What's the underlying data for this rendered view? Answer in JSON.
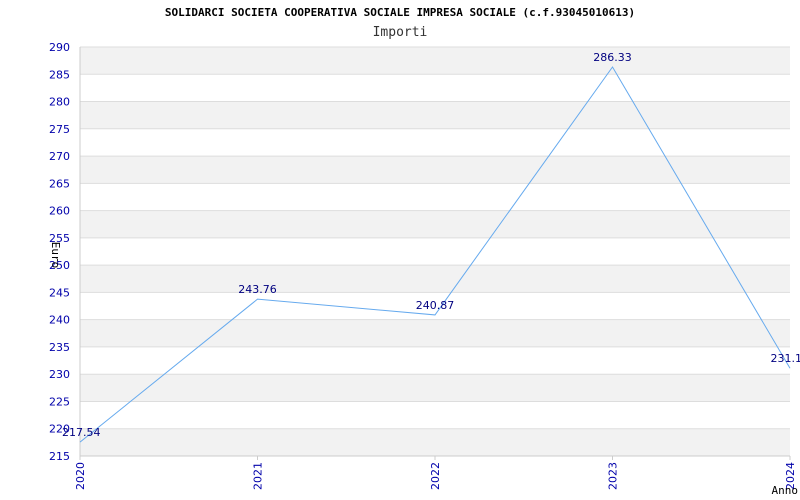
{
  "chart_data": {
    "type": "line",
    "title": "SOLIDARCI SOCIETA COOPERATIVA SOCIALE IMPRESA SOCIALE (c.f.93045010613)",
    "subtitle": "Importi",
    "xlabel": "Anno",
    "ylabel": "Euro",
    "categories": [
      "2020",
      "2021",
      "2022",
      "2023",
      "2024"
    ],
    "series": [
      {
        "values": [
          217.54,
          243.76,
          240.87,
          286.33,
          231.1
        ]
      }
    ],
    "data_labels": [
      "217.54",
      "243.76",
      "240.87",
      "286.33",
      "231.1"
    ],
    "ylim": [
      215,
      290
    ],
    "ytick_step": 5,
    "grid": true,
    "colors": {
      "line": "#66aaee",
      "band": "#f2f2f2",
      "grid": "#dddddd",
      "tick_text": "#0000aa",
      "label_text": "#000080"
    }
  }
}
